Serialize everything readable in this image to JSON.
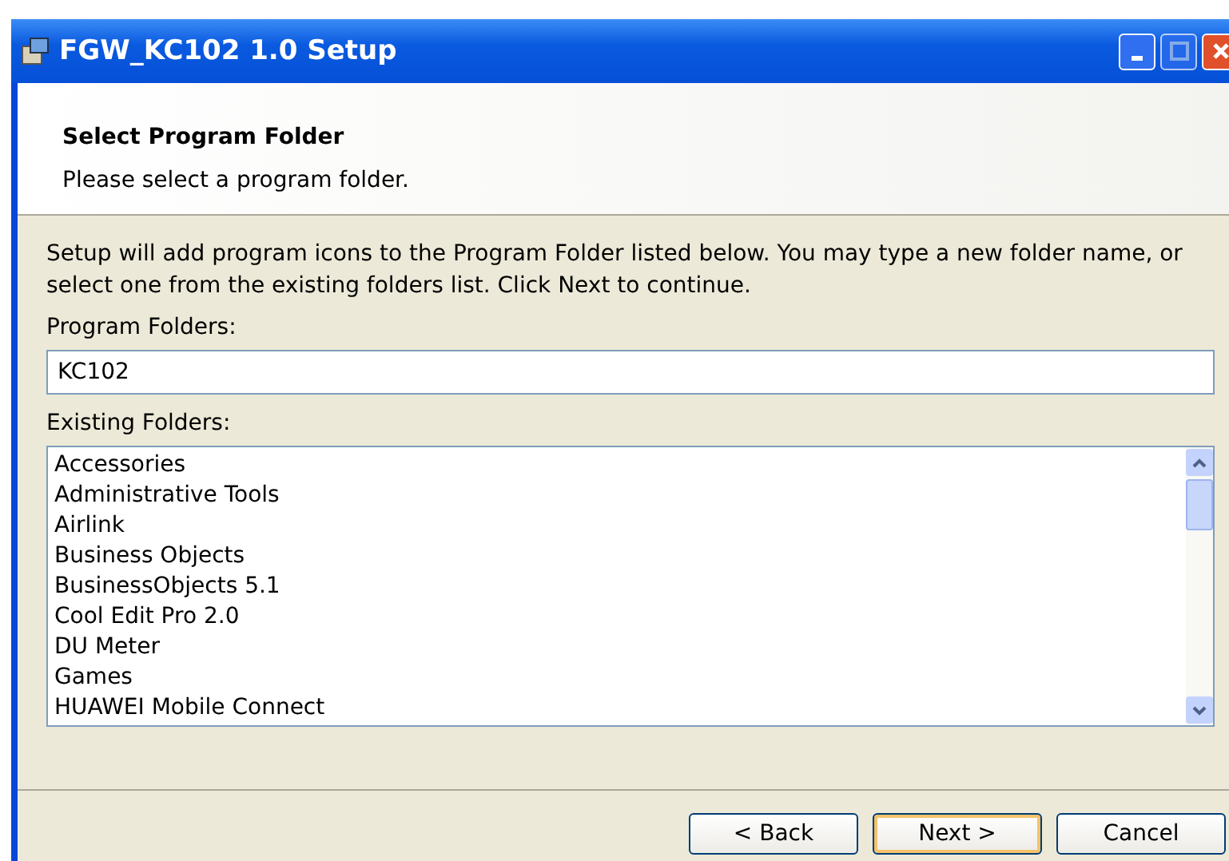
{
  "window": {
    "title": "FGW_KC102 1.0 Setup"
  },
  "header": {
    "title": "Select Program Folder",
    "subtitle": "Please select a program folder."
  },
  "description": "Setup will add program icons to the Program Folder listed below. You may type a new folder name, or select one from the existing folders list. Click Next to continue.",
  "program_folder": {
    "label": "Program Folders:",
    "value": "KC102"
  },
  "existing_folders": {
    "label": "Existing Folders:",
    "items": [
      {
        "label": "Accessories",
        "selected": false
      },
      {
        "label": "Administrative Tools",
        "selected": false
      },
      {
        "label": "Airlink",
        "selected": false
      },
      {
        "label": "Business Objects",
        "selected": false
      },
      {
        "label": "BusinessObjects 5.1",
        "selected": false
      },
      {
        "label": "Cool Edit Pro 2.0",
        "selected": false
      },
      {
        "label": "DU Meter",
        "selected": false
      },
      {
        "label": "Games",
        "selected": false
      },
      {
        "label": "HUAWEI Mobile Connect",
        "selected": false
      }
    ]
  },
  "buttons": [
    {
      "label": "< Back",
      "default": false
    },
    {
      "label": "Next >",
      "default": true
    },
    {
      "label": "Cancel",
      "default": false
    }
  ]
}
